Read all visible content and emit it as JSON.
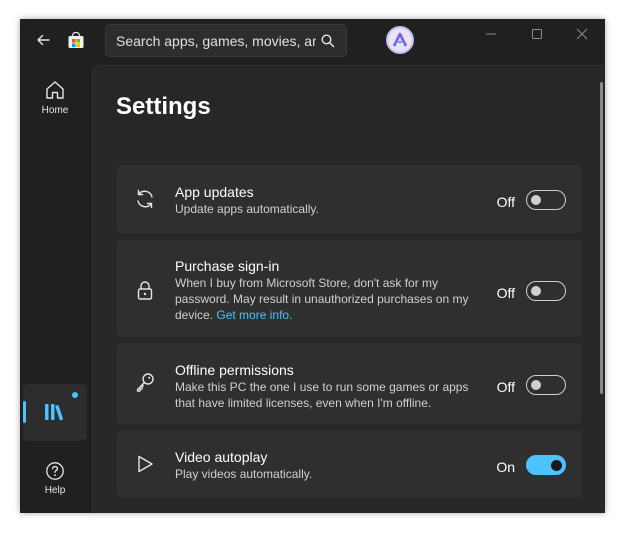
{
  "titlebar": {
    "search_placeholder": "Search apps, games, movies, and more"
  },
  "nav": {
    "home_label": "Home",
    "help_label": "Help"
  },
  "page": {
    "title": "Settings"
  },
  "settings": [
    {
      "title": "App updates",
      "description": "Update apps automatically.",
      "state": "Off",
      "enabled": false,
      "icon": "sync-icon"
    },
    {
      "title": "Purchase sign-in",
      "description": "When I buy from Microsoft Store, don't ask for my password. May result in unauthorized purchases on my device.",
      "link": "Get more info.",
      "state": "Off",
      "enabled": false,
      "icon": "lock-icon"
    },
    {
      "title": "Offline permissions",
      "description": "Make this PC the one I use to run some games or apps that have limited licenses, even when I'm offline.",
      "state": "Off",
      "enabled": false,
      "icon": "key-icon"
    },
    {
      "title": "Video autoplay",
      "description": "Play videos automatically.",
      "state": "On",
      "enabled": true,
      "icon": "play-icon"
    }
  ],
  "colors": {
    "accent": "#4cc2ff",
    "window_bg": "#202020",
    "card_bg": "#2f2f2f"
  }
}
